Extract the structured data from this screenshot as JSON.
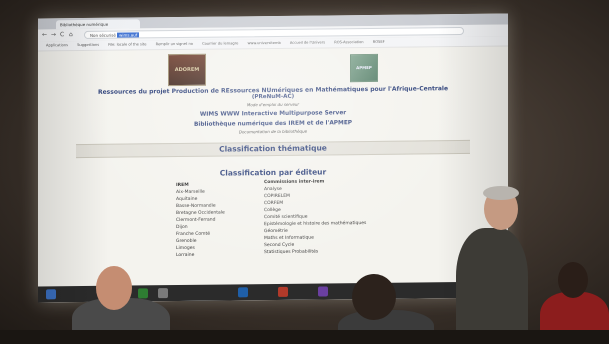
{
  "browser": {
    "tab_title": "Bibliothèque numérique",
    "nav_glyphs": [
      "←",
      "→",
      "C",
      "⌂"
    ],
    "omnibox_prefix": "Non sécurisé",
    "omnibox_selected": "wims.auf",
    "bookmarks": [
      "Applications",
      "Suggestions",
      "File: locale of the site",
      "Remplir un signet no",
      "Courrier du lemagre",
      "www.universitemb",
      "Accueil de l'Univers",
      "ROS-Association",
      "ROSEF"
    ]
  },
  "page": {
    "logo_left": "ADOREM",
    "logo_right": "APMEP",
    "title_line1": "Ressources du projet Production de REssources NUmériques en Mathématiques pour l'Afrique-Centrale",
    "title_line2": "(PReNuM-AC)",
    "manual_link": "Mode d'emploi du serveur",
    "wims_line": "WIMS WWW Interactive Multipurpose Server",
    "library_title": "Bibliothèque numérique des IREM et de l'APMEP",
    "library_doc": "Documentation de la bibliothèque",
    "section_thematic": "Classification thématique",
    "section_editor": "Classification par éditeur",
    "col_irem_head": "IREM",
    "col_irem_items": [
      "Aix-Marseille",
      "Aquitaine",
      "Basse-Normandie",
      "Bretagne Occidentale",
      "Clermont-Ferrand",
      "Dijon",
      "Franche Comté",
      "Grenoble",
      "Limoges",
      "Lorraine"
    ],
    "col_comm_head": "Commissions inter-irem",
    "col_comm_items": [
      "Analyse",
      "COPIRELEM",
      "CORFEM",
      "Collège",
      "Comité scientifique",
      "Epistémologie et histoire des mathématiques",
      "Géométrie",
      "Maths et Informatique",
      "Second Cycle",
      "Statistiques Probabilités"
    ]
  },
  "colors": {
    "heading_blue": "#2a3e78",
    "screen_bg": "#ecebe6",
    "room_dark": "#2a241f",
    "shirt_dark": "#3b3b3b",
    "shirt_red": "#8c1d1d"
  }
}
